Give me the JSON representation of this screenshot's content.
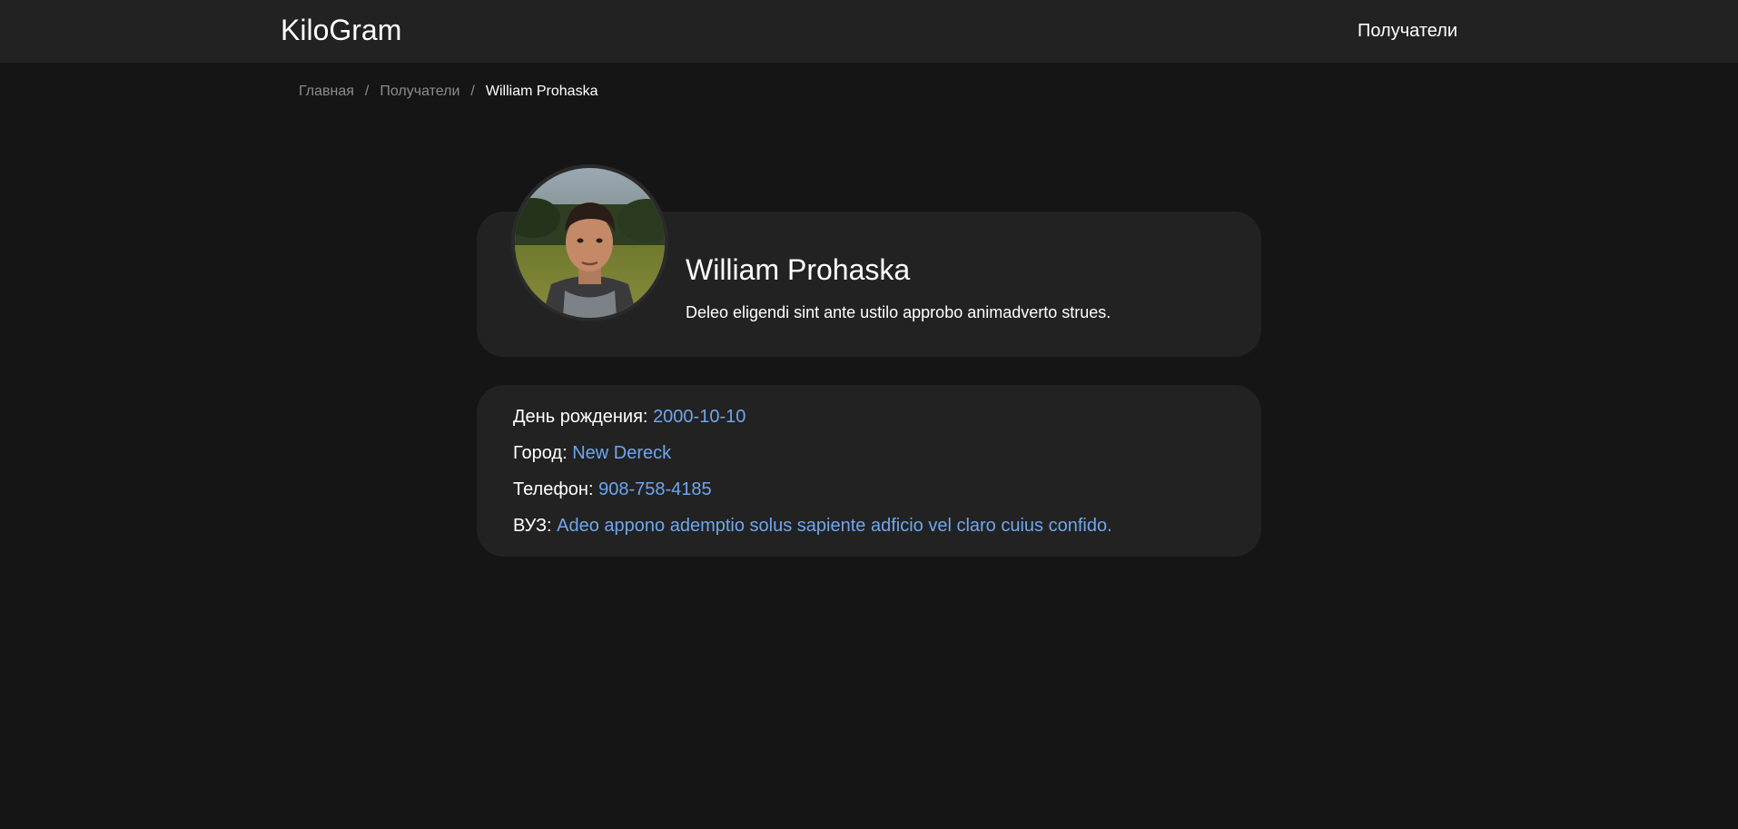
{
  "navbar": {
    "brand": "KiloGram",
    "recipients_link": "Получатели"
  },
  "breadcrumb": {
    "items": [
      "Главная",
      "Получатели"
    ],
    "separator": "/",
    "current": "William Prohaska"
  },
  "profile": {
    "name": "William Prohaska",
    "bio": "Deleo eligendi sint ante ustilo approbo animadverto strues.",
    "avatar_icon": "user-photo"
  },
  "details": {
    "birthday_label": "День рождения:",
    "birthday_value": "2000-10-10",
    "city_label": "Город:",
    "city_value": "New Dereck",
    "phone_label": "Телефон:",
    "phone_value": "908-758-4185",
    "university_label": "ВУЗ:",
    "university_value": "Adeo appono ademptio solus sapiente adficio vel claro cuius confido."
  },
  "colors": {
    "background": "#151515",
    "surface": "#222222",
    "accent": "#6ea6f0",
    "muted": "#8c8c8c"
  }
}
